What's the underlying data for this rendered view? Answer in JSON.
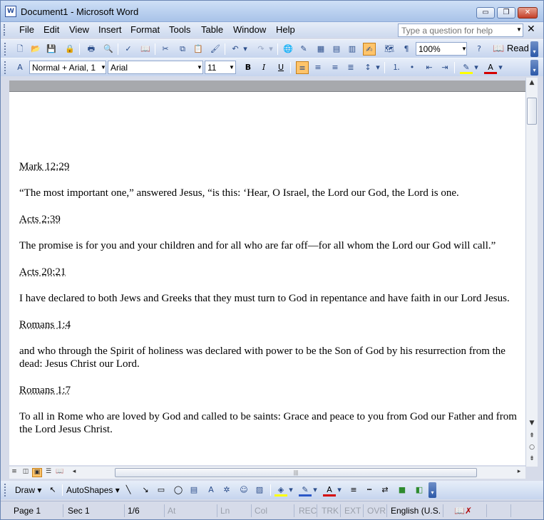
{
  "window": {
    "title": "Document1 - Microsoft Word",
    "app_icon_letter": "W"
  },
  "controls": {
    "minimize": "▭",
    "maximize": "❐",
    "close": "✕"
  },
  "menu": {
    "items": [
      "File",
      "Edit",
      "View",
      "Insert",
      "Format",
      "Tools",
      "Table",
      "Window",
      "Help"
    ],
    "ask_placeholder": "Type a question for help",
    "close_glyph": "✕"
  },
  "standard_toolbar": {
    "zoom": "100%",
    "read_label": "Read"
  },
  "formatting_toolbar": {
    "style": "Normal + Arial, 1",
    "font": "Arial",
    "size": "11",
    "bold": "B",
    "italic": "I",
    "underline": "U"
  },
  "document": {
    "blocks": [
      {
        "type": "ref",
        "text": "Mark 12:29"
      },
      {
        "type": "verse",
        "text": "“The most important one,” answered Jesus, “is this:  ‘Hear, O Israel, the Lord our God, the Lord is one."
      },
      {
        "type": "ref",
        "text": "Acts 2:39"
      },
      {
        "type": "verse",
        "text": "The promise is for you and your children and for all who are far off—for all whom the Lord our God will call.”"
      },
      {
        "type": "ref",
        "text": "Acts 20:21"
      },
      {
        "type": "verse",
        "text": "I have declared to both Jews and Greeks that they must turn to God in repentance and have faith in our Lord Jesus."
      },
      {
        "type": "ref",
        "text": "Romans 1:4"
      },
      {
        "type": "verse",
        "text": "and who through the Spirit of holiness was declared with power to be the Son of God by his resurrection from the dead: Jesus Christ our Lord."
      },
      {
        "type": "ref",
        "text": "Romans 1:7"
      },
      {
        "type": "verse",
        "text": "To all in Rome who are loved by God and called to be saints: Grace and peace to you from God our Father and from the Lord Jesus Christ."
      }
    ]
  },
  "drawing_toolbar": {
    "draw_label": "Draw",
    "autoshapes_label": "AutoShapes"
  },
  "status": {
    "page": "Page  1",
    "sec": "Sec  1",
    "pages": "1/6",
    "at": "At",
    "ln": "Ln",
    "col": "Col",
    "rec": "REC",
    "trk": "TRK",
    "ext": "EXT",
    "ovr": "OVR",
    "language": "English (U.S."
  },
  "colors": {
    "accent_active": "#ffc46a",
    "title_gradient": "#b9d0ef",
    "highlight_yellow": "#ffff00",
    "font_red": "#d40000"
  }
}
